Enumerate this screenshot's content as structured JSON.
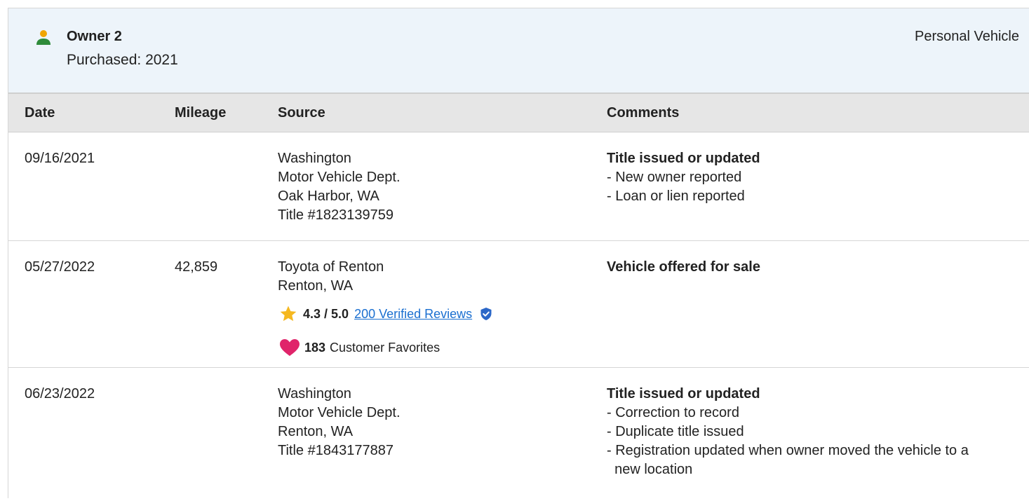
{
  "owner": {
    "name": "Owner 2",
    "purchased": "Purchased: 2021",
    "vehicle_type": "Personal Vehicle"
  },
  "table": {
    "headers": [
      "Date",
      "Mileage",
      "Source",
      "Comments"
    ],
    "rows": [
      {
        "date": "09/16/2021",
        "mileage": "",
        "source": [
          "Washington",
          "Motor Vehicle Dept.",
          "Oak Harbor, WA",
          "Title #1823139759"
        ],
        "comment_title": "Title issued or updated",
        "comment_items": [
          "- New owner reported",
          "- Loan or lien reported"
        ]
      },
      {
        "date": "05/27/2022",
        "mileage": "42,859",
        "source": [
          "Toyota of Renton",
          "Renton, WA"
        ],
        "rating": "4.3 / 5.0",
        "reviews": "200 Verified Reviews",
        "favorites_count": "183",
        "favorites_label": "Customer Favorites",
        "comment_title": "Vehicle offered for sale",
        "comment_items": []
      },
      {
        "date": "06/23/2022",
        "mileage": "",
        "source": [
          "Washington",
          "Motor Vehicle Dept.",
          "Renton, WA",
          "Title #1843177887"
        ],
        "comment_title": "Title issued or updated",
        "comment_items": [
          "- Correction to record",
          "- Duplicate title issued",
          "- Registration updated when owner moved the vehicle to a",
          "  new location"
        ]
      }
    ]
  },
  "colors": {
    "header_bg": "#edf4fa",
    "table_head_bg": "#e6e6e6",
    "owner_icon_green": "#2e8b3a",
    "owner_icon_orange": "#f0a500",
    "star": "#f5b820",
    "link": "#1a6fd0",
    "verified": "#2b67c8",
    "heart": "#e0246a"
  },
  "icons": {
    "owner": "person-icon",
    "star": "star-icon",
    "verified": "verified-shield-icon",
    "heart": "heart-icon"
  }
}
